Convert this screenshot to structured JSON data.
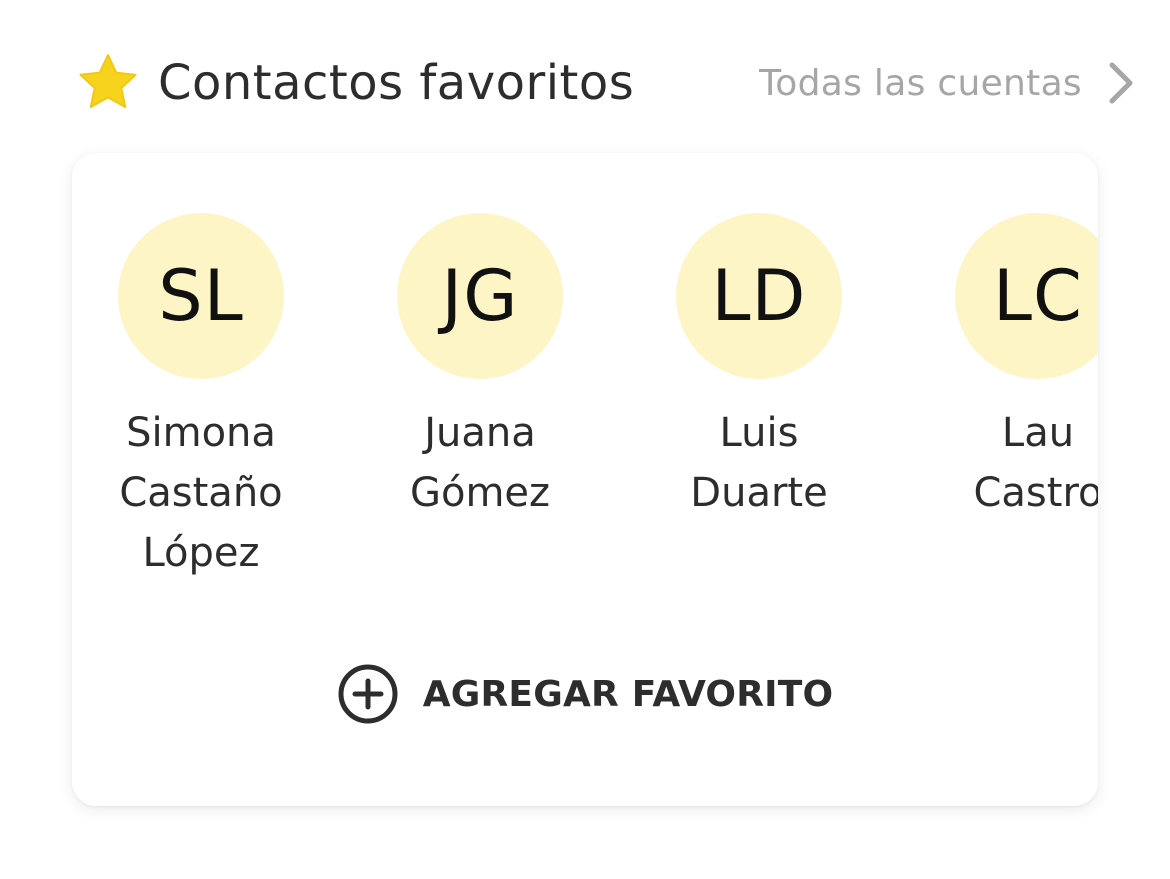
{
  "header": {
    "title": "Contactos favoritos",
    "all_accounts_label": "Todas las cuentas",
    "star_icon": "star-icon",
    "chevron_icon": "chevron-right-icon"
  },
  "contacts": [
    {
      "initials": "SL",
      "name": "Simona\nCastaño\nLópez"
    },
    {
      "initials": "JG",
      "name": "Juana\nGómez"
    },
    {
      "initials": "LD",
      "name": "Luis\nDuarte"
    },
    {
      "initials": "LC",
      "name": "Lau\nCastro"
    }
  ],
  "add_favorite": {
    "label": "AGREGAR FAVORITO",
    "icon": "plus-circle-icon"
  },
  "colors": {
    "star": "#f7d31d",
    "avatar_bg": "#fdf5c6",
    "text_primary": "#2d2d2d",
    "text_muted": "#a6a6a6"
  }
}
